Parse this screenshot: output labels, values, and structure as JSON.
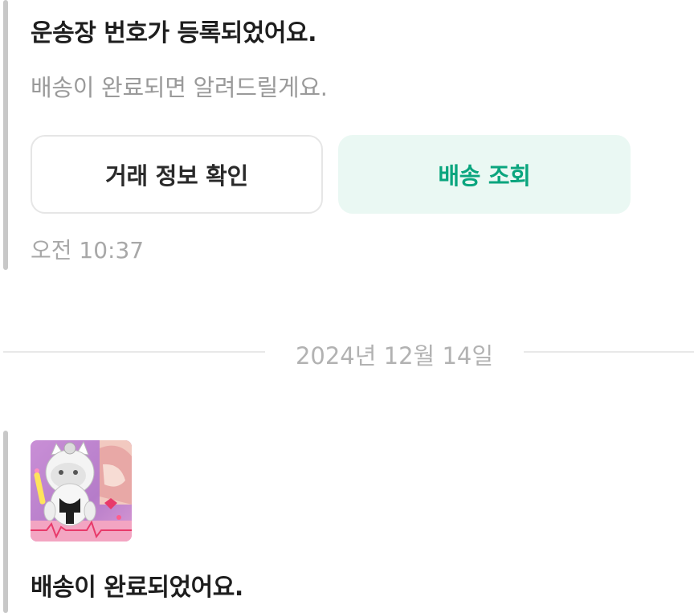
{
  "messages": [
    {
      "title": "운송장 번호가 등록되었어요.",
      "subtitle": "배송이 완료되면 알려드릴게요.",
      "buttons": {
        "trade_info": "거래 정보 확인",
        "track_shipping": "배송 조회"
      },
      "time": "오전 10:37"
    },
    {
      "title": "배송이 완료되었어요."
    }
  ],
  "date_separator": "2024년 12월 14일",
  "colors": {
    "accent_text": "#0aa57e",
    "accent_bg": "#eaf8f3",
    "quote_bar": "#c8c8c8",
    "muted_text": "#9a9a9a"
  },
  "icons": {
    "product_thumbnail": "plush-cat-doll-image"
  }
}
